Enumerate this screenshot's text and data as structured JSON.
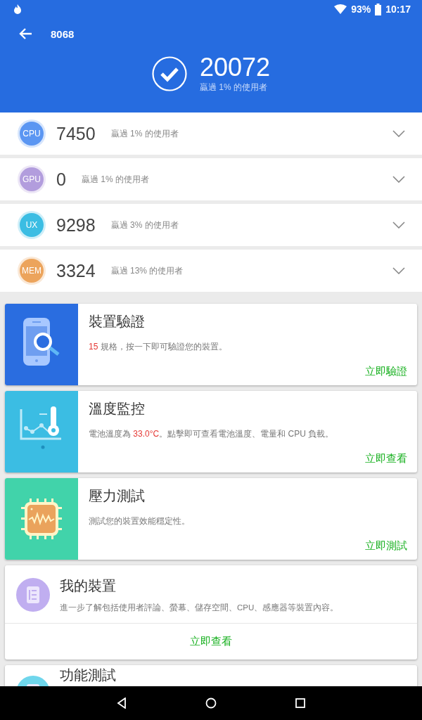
{
  "status_bar": {
    "battery": "93%",
    "time": "10:17"
  },
  "header": {
    "title": "8068",
    "score": "20072",
    "subtitle": "贏過 1% 的使用者"
  },
  "scores": [
    {
      "badge": "CPU",
      "color": "#5b96f2",
      "score": "7450",
      "rank": "贏過 1% 的使用者",
      "expanded": false
    },
    {
      "badge": "GPU",
      "color": "#b29ddd",
      "score": "0",
      "rank": "贏過 1% 的使用者",
      "expanded": false
    },
    {
      "badge": "UX",
      "color": "#3bbde3",
      "score": "9298",
      "rank": "贏過 3% 的使用者",
      "expanded": false
    },
    {
      "badge": "MEM",
      "color": "#eca45c",
      "score": "3324",
      "rank": "贏過 13% 的使用者",
      "expanded": false
    }
  ],
  "cards": [
    {
      "kind": "verify",
      "color": "#2a6de0",
      "title": "裝置驗證",
      "text": "**15** 規格，按一下即可驗證您的裝置。",
      "action": "立即驗證"
    },
    {
      "kind": "temperature",
      "color": "#3bbde3",
      "title": "溫度監控",
      "text": "電池溫度為 **33.0°C**。點擊即可查看電池溫度、電量和 CPU 負載。",
      "action": "立即查看"
    },
    {
      "kind": "stress",
      "color": "#41d3aa",
      "title": "壓力測試",
      "text": "測試您的裝置效能穩定性。",
      "action": "立即測試"
    },
    {
      "kind": "info",
      "color": "#c0aef0",
      "title": "我的裝置",
      "text": "進一步了解包括使用者評論、螢幕、儲存空間、CPU、感應器等裝置內容。",
      "action": "立即查看"
    },
    {
      "kind": "info_partial",
      "color": "#6fd6ec",
      "title": "功能測試"
    }
  ]
}
